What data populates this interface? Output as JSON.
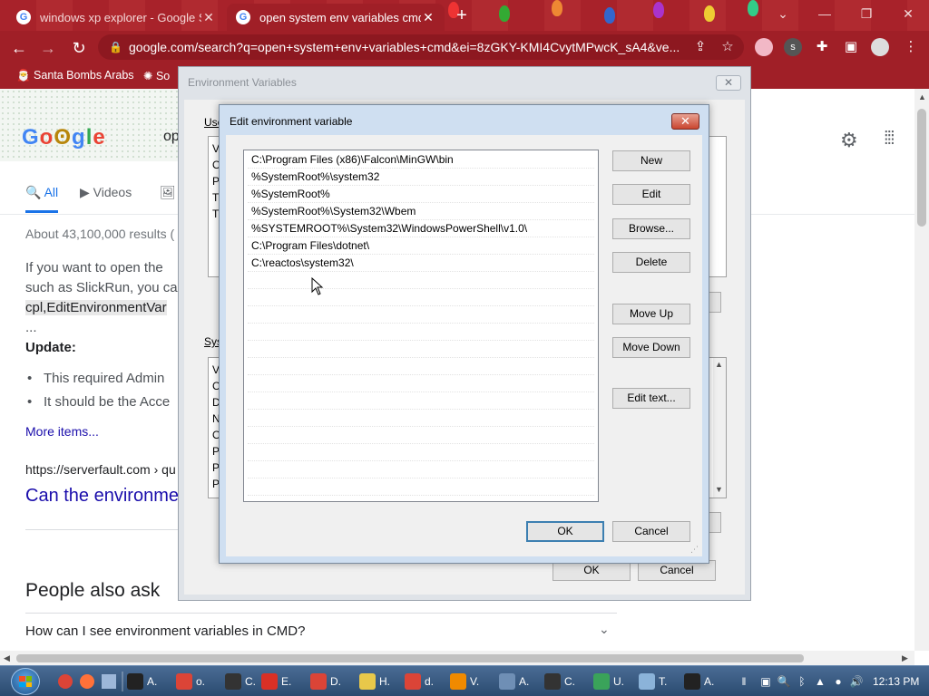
{
  "browser": {
    "tabs": [
      {
        "title": "windows xp explorer - Google S",
        "active": false
      },
      {
        "title": "open system env variables cmd",
        "active": true
      }
    ],
    "url": "google.com/search?q=open+system+env+variables+cmd&ei=8zGKY-KMI4CvytMPwcK_sA4&ve...",
    "bookmarks": [
      "Santa Bombs Arabs",
      "So"
    ]
  },
  "google": {
    "tabs": [
      "All",
      "Videos"
    ],
    "search_tail": "op",
    "result_count": "About 43,100,000 results (",
    "snippet_lines": [
      "If you want to open the",
      "such as SlickRun, you ca",
      "cpl,EditEnvironmentVar",
      "..."
    ],
    "update_label": "Update:",
    "bullets": [
      "This required Admin",
      "It should be the Acce"
    ],
    "more_items": "More items...",
    "cite": "https://serverfault.com › qu",
    "result_title": "Can the environme",
    "paa_heading": "People also ask",
    "paa_question": "How can I see environment variables in CMD?"
  },
  "env_dialog": {
    "title": "Environment Variables",
    "user_group": "Use",
    "system_group": "Sys",
    "user_list_chars": [
      "V",
      "O",
      "P",
      "T",
      "T"
    ],
    "system_list_chars": [
      "V",
      "C",
      "D",
      "N",
      "O",
      "P",
      "P",
      "P"
    ],
    "ok": "OK",
    "cancel": "Cancel"
  },
  "edit_dialog": {
    "title": "Edit environment variable",
    "paths": [
      "C:\\Program Files (x86)\\Falcon\\MinGW\\bin",
      "%SystemRoot%\\system32",
      "%SystemRoot%",
      "%SystemRoot%\\System32\\Wbem",
      "%SYSTEMROOT%\\System32\\WindowsPowerShell\\v1.0\\",
      "C:\\Program Files\\dotnet\\",
      "C:\\reactos\\system32\\"
    ],
    "buttons": {
      "new": "New",
      "edit": "Edit",
      "browse": "Browse...",
      "delete": "Delete",
      "move_up": "Move Up",
      "move_down": "Move Down",
      "edit_text": "Edit text...",
      "ok": "OK",
      "cancel": "Cancel"
    }
  },
  "taskbar": {
    "items": [
      {
        "label": "A.",
        "icon": "cmd-icon",
        "color": "#222222"
      },
      {
        "label": "o.",
        "icon": "chrome-icon",
        "color": "#db4437"
      },
      {
        "label": "C.",
        "icon": "7zip-icon",
        "color": "#333333"
      },
      {
        "label": "E.",
        "icon": "error-icon",
        "color": "#d93025"
      },
      {
        "label": "D.",
        "icon": "chrome-icon",
        "color": "#db4437"
      },
      {
        "label": "H.",
        "icon": "help-icon",
        "color": "#e8c84a"
      },
      {
        "label": "d.",
        "icon": "chrome-icon",
        "color": "#db4437"
      },
      {
        "label": "V.",
        "icon": "vlc-icon",
        "color": "#f08a00"
      },
      {
        "label": "A.",
        "icon": "app-icon",
        "color": "#6f8fb5"
      },
      {
        "label": "C.",
        "icon": "7zip-icon",
        "color": "#333333"
      },
      {
        "label": "U.",
        "icon": "notepad-icon",
        "color": "#3aa35a"
      },
      {
        "label": "T.",
        "icon": "image-icon",
        "color": "#8bb3d9"
      },
      {
        "label": "A.",
        "icon": "cmd-icon",
        "color": "#222222"
      }
    ],
    "clock": "12:13 PM"
  }
}
